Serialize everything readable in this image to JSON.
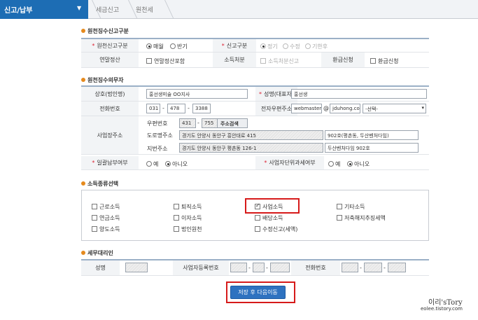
{
  "header": {
    "menu_title": "신고/납부",
    "crumb1": "세금신고",
    "crumb2": "원천세"
  },
  "sec1": {
    "title": "원천징수신고구분",
    "l_period": "원천신고구분",
    "r_monthly": "매월",
    "r_half": "반기",
    "l_type": "신고구분",
    "r_regular": "정기",
    "r_amend": "수정",
    "r_late": "기한후",
    "l_yearend": "연말정산",
    "c_yearend": "연말정산포함",
    "l_income": "소득처분",
    "c_income": "소득처분신고",
    "l_refund": "환급신청",
    "c_refund": "환급신청"
  },
  "sec2": {
    "title": "원천징수의무자",
    "l_company": "상호(법인명)",
    "v_company": "홍선생미술 OO지사",
    "l_ceo": "성명(대표자)",
    "v_ceo": "홍선생",
    "l_phone": "전화번호",
    "v_p1": "031",
    "v_p2": "478",
    "v_p3": "3388",
    "l_email": "전자우편주소",
    "v_email1": "webmaster",
    "at": "@",
    "v_email2": "jduhong.com",
    "v_email3": "-선택-",
    "l_addr": "사업장주소",
    "l_zip": "우편번호",
    "v_z1": "431",
    "v_z2": "755",
    "b_zip": "주소검색",
    "l_road": "도로명주소",
    "v_road": "경기도 안양시 동안구 흥안대로 415",
    "v_road2": "902호(평촌동, 두산벤처다임)",
    "l_lot": "지번주소",
    "v_lot": "경기도 안양시 동안구 평촌동 126-1",
    "v_lot2": "두산벤처다임 902호",
    "l_bulk": "일괄납부여부",
    "r_yes": "예",
    "r_no": "아니오",
    "l_unit": "사업자단위과세여부",
    "r_yes2": "예",
    "r_no2": "아니오",
    "dash": "-"
  },
  "sec3": {
    "title": "소득종류선택",
    "items": [
      "근로소득",
      "퇴직소득",
      "사업소득",
      "기타소득",
      "연금소득",
      "이자소득",
      "배당소득",
      "저축해지추징세액",
      "양도소득",
      "법인원천",
      "수정신고(세액)"
    ]
  },
  "sec4": {
    "title": "세무대리인",
    "l_name": "성명",
    "l_reg": "사업자등록번호",
    "l_phone": "전화번호"
  },
  "save": "저장 후 다음이동",
  "watermark": {
    "line1": "이리'sTory",
    "line2": "eolee.tistory.com"
  },
  "colors": {
    "accent": "#1d6db4",
    "required": "#d23",
    "highlight": "#d61a1a"
  }
}
